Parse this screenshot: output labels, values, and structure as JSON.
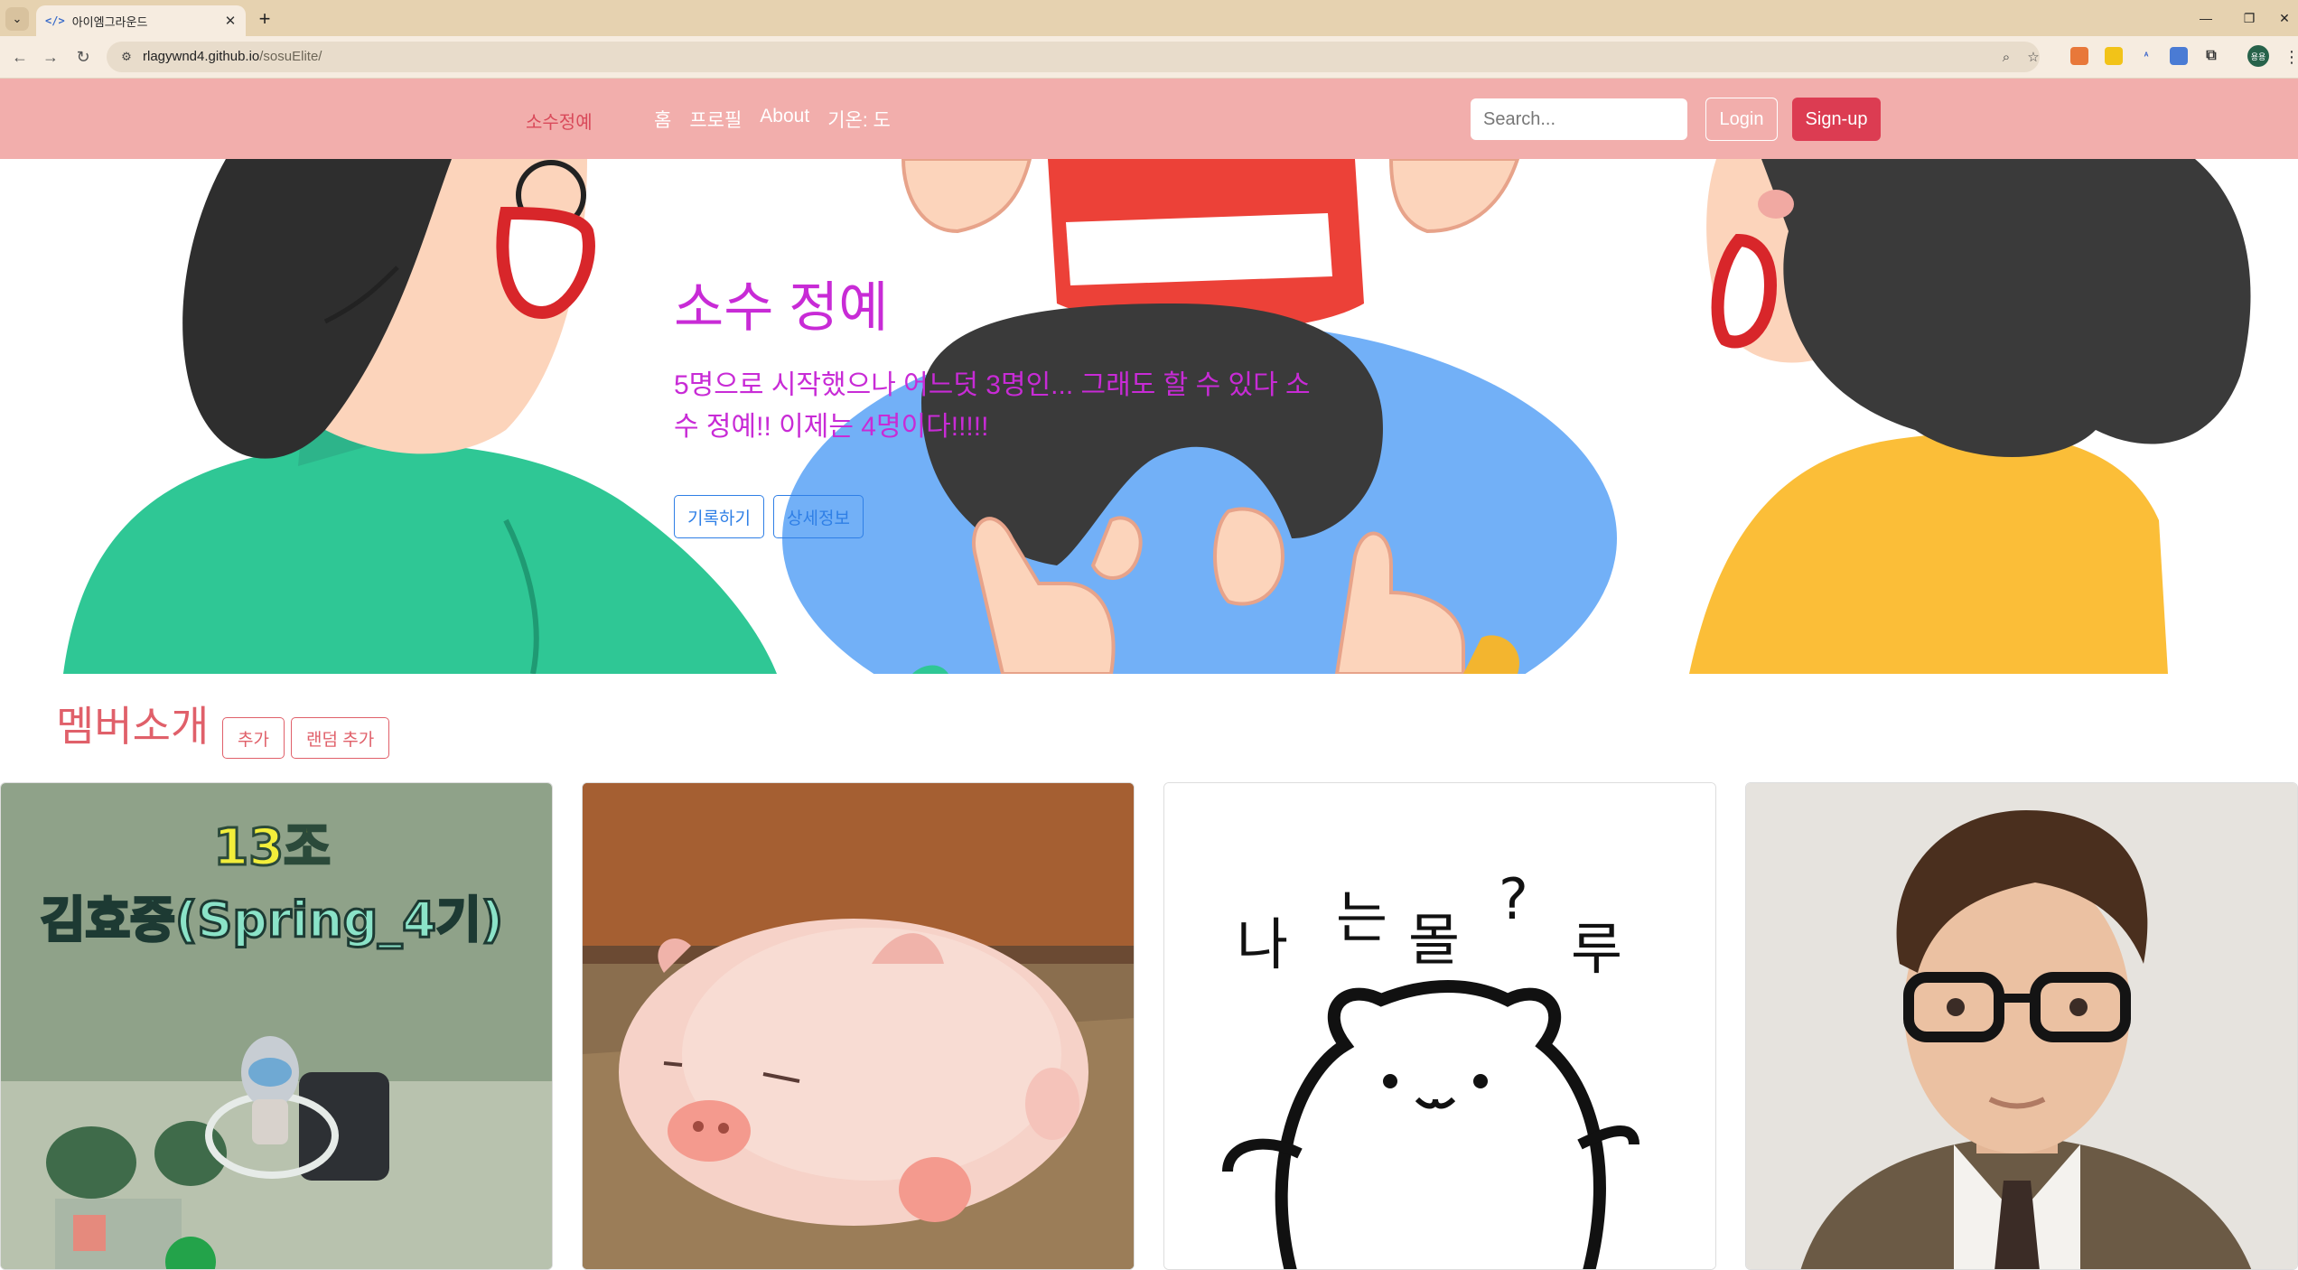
{
  "browser": {
    "tab_title": "아이엠그라운드",
    "tab_favicon": "</>",
    "url_host": "rlagywnd4.github.io",
    "url_path": "/sosuElite/",
    "profile_initials": "용용"
  },
  "navbar": {
    "brand": "소수정예",
    "links": [
      "홈",
      "프로필",
      "About",
      "기온: 도"
    ],
    "search_placeholder": "Search...",
    "login_label": "Login",
    "signup_label": "Sign-up"
  },
  "hero": {
    "title": "소수 정예",
    "description": "5명으로 시작했으나 어느덧 3명인... 그래도 할 수 있다 소수 정예!! 이제는 4명이다!!!!!",
    "buttons": [
      "기록하기",
      "상세정보"
    ]
  },
  "members": {
    "title": "멤버소개",
    "add_label": "추가",
    "random_add_label": "랜덤 추가",
    "card1_text_line1": "13조",
    "card1_text_line2": "김효중(Spring_4기)",
    "card3_text": [
      "나",
      "는",
      "몰",
      "?",
      "루"
    ]
  },
  "colors": {
    "navbar_bg": "#f2aeac",
    "brand": "#d94a5a",
    "hero_text": "#c82bd6",
    "hero_button": "#2f7fe6",
    "section_accent": "#e0606a",
    "signup_bg": "#dc3c52"
  }
}
